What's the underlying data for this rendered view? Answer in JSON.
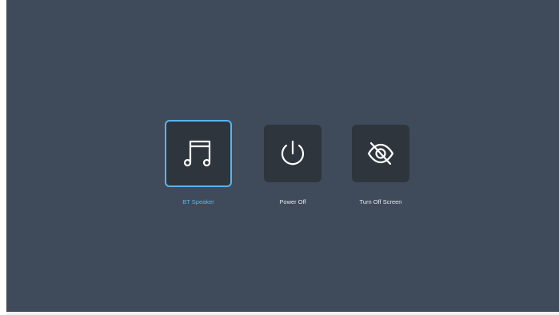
{
  "theme": {
    "background": "#3f4b5a",
    "tile": "#2e353d",
    "selected_accent": "#5ab4ec",
    "label_color": "#e6e9ee"
  },
  "menu": {
    "items": [
      {
        "label": "BT Speaker",
        "icon": "music-note-icon",
        "selected": true
      },
      {
        "label": "Power Off",
        "icon": "power-icon",
        "selected": false
      },
      {
        "label": "Turn Off Screen",
        "icon": "eye-off-icon",
        "selected": false
      }
    ]
  }
}
